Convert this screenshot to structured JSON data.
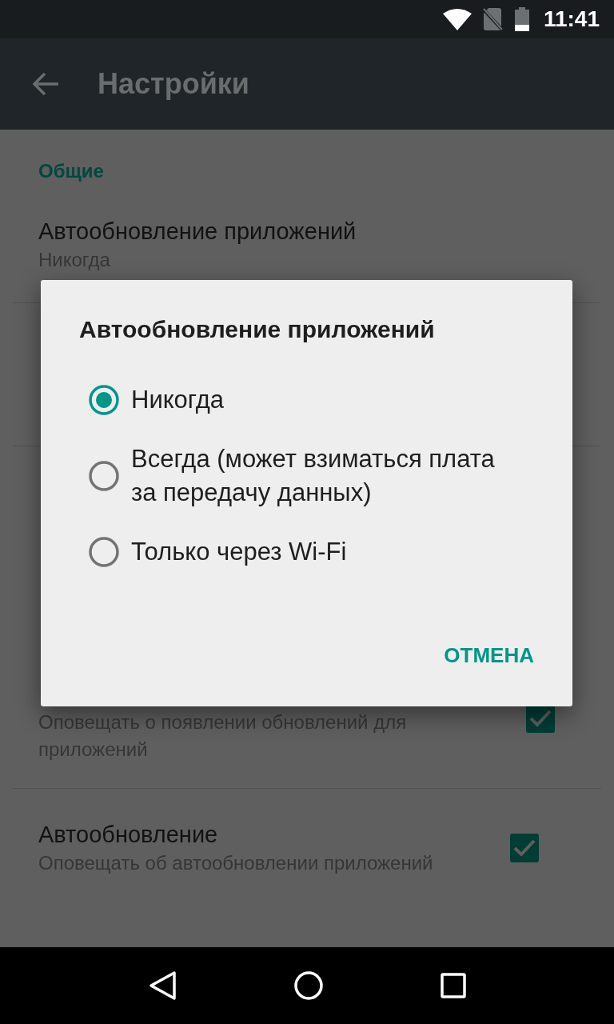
{
  "status_bar": {
    "time": "11:41"
  },
  "toolbar": {
    "title": "Настройки"
  },
  "settings": {
    "section": "Общие",
    "items": [
      {
        "kind": "value",
        "title": "Автообновление приложений",
        "summary": "Никогда"
      },
      {
        "kind": "checkbox",
        "summary": "Оповещать о появлении обновлений для приложений",
        "checked": true
      },
      {
        "kind": "checkbox",
        "title": "Автообновление",
        "summary": "Оповещать об автообновлении приложений",
        "checked": true
      }
    ]
  },
  "dialog": {
    "title": "Автообновление приложений",
    "options": [
      {
        "label": "Никогда",
        "selected": true
      },
      {
        "label": "Всегда (может взиматься плата за передачу данных)",
        "selected": false
      },
      {
        "label": "Только через Wi-Fi",
        "selected": false
      }
    ],
    "button": "ОТМЕНА"
  }
}
